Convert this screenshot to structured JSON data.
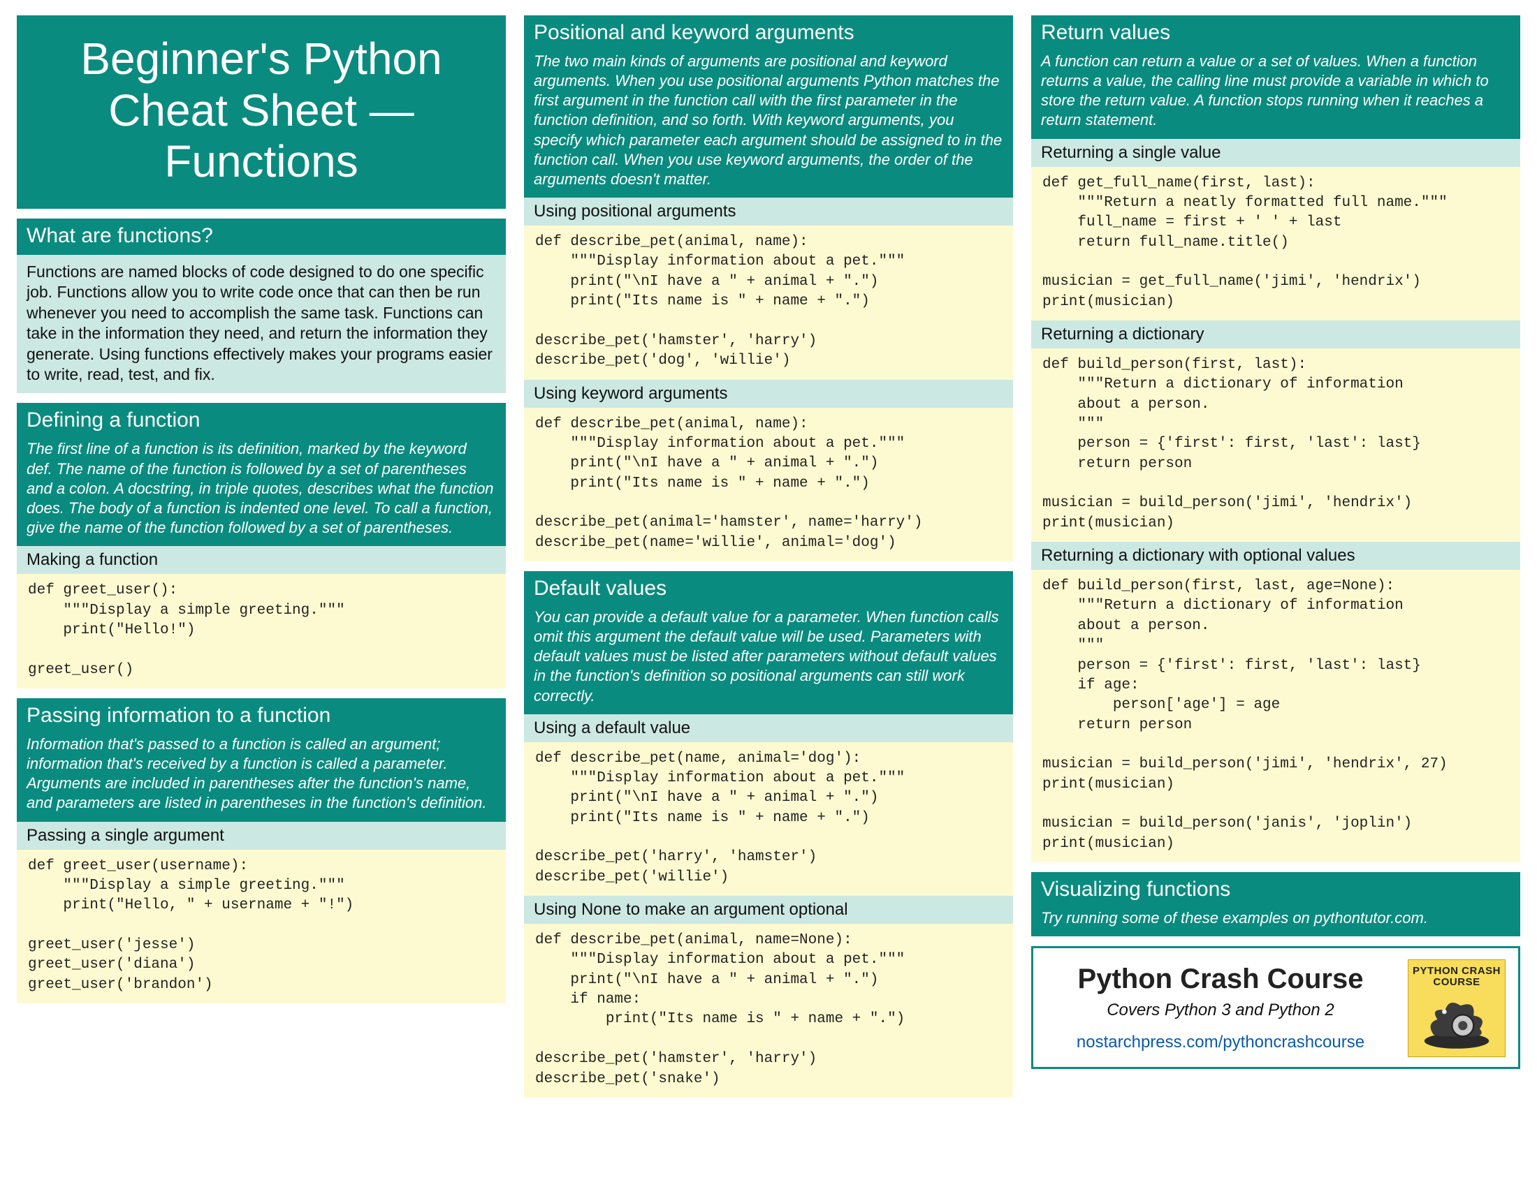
{
  "title": "Beginner's Python Cheat Sheet — Functions",
  "col1": {
    "what": {
      "head": "What are functions?",
      "body": "Functions are named blocks of code designed to do one specific job. Functions allow you to write code once that can then be run whenever you need to accomplish the same task. Functions can take in the information they need, and return the information they generate. Using functions effectively makes your programs easier to write, read, test, and fix."
    },
    "defining": {
      "head": "Defining a function",
      "desc": "The first line of a function is its definition, marked by the keyword def. The name of the function is followed by a set of parentheses and a colon. A docstring, in triple quotes, describes what the function does. The body of a function is indented one level.\n    To call a function, give the name of the function followed by a set of parentheses.",
      "sub1": "Making a function",
      "code1": "def greet_user():\n    \"\"\"Display a simple greeting.\"\"\"\n    print(\"Hello!\")\n\ngreet_user()"
    },
    "passing": {
      "head": "Passing information to a function",
      "desc": "Information that's passed to a function is called an argument; information that's received by a function is called a parameter. Arguments are included in parentheses after the function's name, and parameters are listed in parentheses in the function's definition.",
      "sub1": "Passing a single argument",
      "code1": "def greet_user(username):\n    \"\"\"Display a simple greeting.\"\"\"\n    print(\"Hello, \" + username + \"!\")\n\ngreet_user('jesse')\ngreet_user('diana')\ngreet_user('brandon')"
    }
  },
  "col2": {
    "poskey": {
      "head": "Positional and keyword arguments",
      "desc": "The two main kinds of arguments are positional and keyword arguments. When you use positional arguments Python matches the first argument in the function call with the first parameter in the function definition, and so forth.\n    With keyword arguments, you specify which parameter each argument should be assigned to in the function call. When you use keyword arguments, the order of the arguments doesn't matter.",
      "sub1": "Using positional arguments",
      "code1": "def describe_pet(animal, name):\n    \"\"\"Display information about a pet.\"\"\"\n    print(\"\\nI have a \" + animal + \".\")\n    print(\"Its name is \" + name + \".\")\n\ndescribe_pet('hamster', 'harry')\ndescribe_pet('dog', 'willie')",
      "sub2": "Using keyword arguments",
      "code2": "def describe_pet(animal, name):\n    \"\"\"Display information about a pet.\"\"\"\n    print(\"\\nI have a \" + animal + \".\")\n    print(\"Its name is \" + name + \".\")\n\ndescribe_pet(animal='hamster', name='harry')\ndescribe_pet(name='willie', animal='dog')"
    },
    "defaults": {
      "head": "Default values",
      "desc": "You can provide a default value for a parameter. When function calls omit this argument the default value will be used. Parameters with default values must be listed after parameters without default values in the function's definition so positional arguments can still work correctly.",
      "sub1": "Using a default value",
      "code1": "def describe_pet(name, animal='dog'):\n    \"\"\"Display information about a pet.\"\"\"\n    print(\"\\nI have a \" + animal + \".\")\n    print(\"Its name is \" + name + \".\")\n\ndescribe_pet('harry', 'hamster')\ndescribe_pet('willie')",
      "sub2": "Using None to make an argument optional",
      "code2": "def describe_pet(animal, name=None):\n    \"\"\"Display information about a pet.\"\"\"\n    print(\"\\nI have a \" + animal + \".\")\n    if name:\n        print(\"Its name is \" + name + \".\")\n\ndescribe_pet('hamster', 'harry')\ndescribe_pet('snake')"
    }
  },
  "col3": {
    "return": {
      "head": "Return values",
      "desc": "A function can return a value or a set of values. When a function returns a value, the calling line must provide a variable in which to store the return value. A function stops running when it reaches a return statement.",
      "sub1": "Returning a single value",
      "code1": "def get_full_name(first, last):\n    \"\"\"Return a neatly formatted full name.\"\"\"\n    full_name = first + ' ' + last\n    return full_name.title()\n\nmusician = get_full_name('jimi', 'hendrix')\nprint(musician)",
      "sub2": "Returning a dictionary",
      "code2": "def build_person(first, last):\n    \"\"\"Return a dictionary of information\n    about a person.\n    \"\"\"\n    person = {'first': first, 'last': last}\n    return person\n\nmusician = build_person('jimi', 'hendrix')\nprint(musician)",
      "sub3": "Returning a dictionary with optional values",
      "code3": "def build_person(first, last, age=None):\n    \"\"\"Return a dictionary of information\n    about a person.\n    \"\"\"\n    person = {'first': first, 'last': last}\n    if age:\n        person['age'] = age\n    return person\n\nmusician = build_person('jimi', 'hendrix', 27)\nprint(musician)\n\nmusician = build_person('janis', 'joplin')\nprint(musician)"
    },
    "viz": {
      "head": "Visualizing functions",
      "desc": "Try running some of these examples on pythontutor.com."
    },
    "promo": {
      "title": "Python Crash Course",
      "sub": "Covers Python 3 and Python 2",
      "link": "nostarchpress.com/pythoncrashcourse",
      "book_title": "PYTHON CRASH COURSE"
    }
  }
}
